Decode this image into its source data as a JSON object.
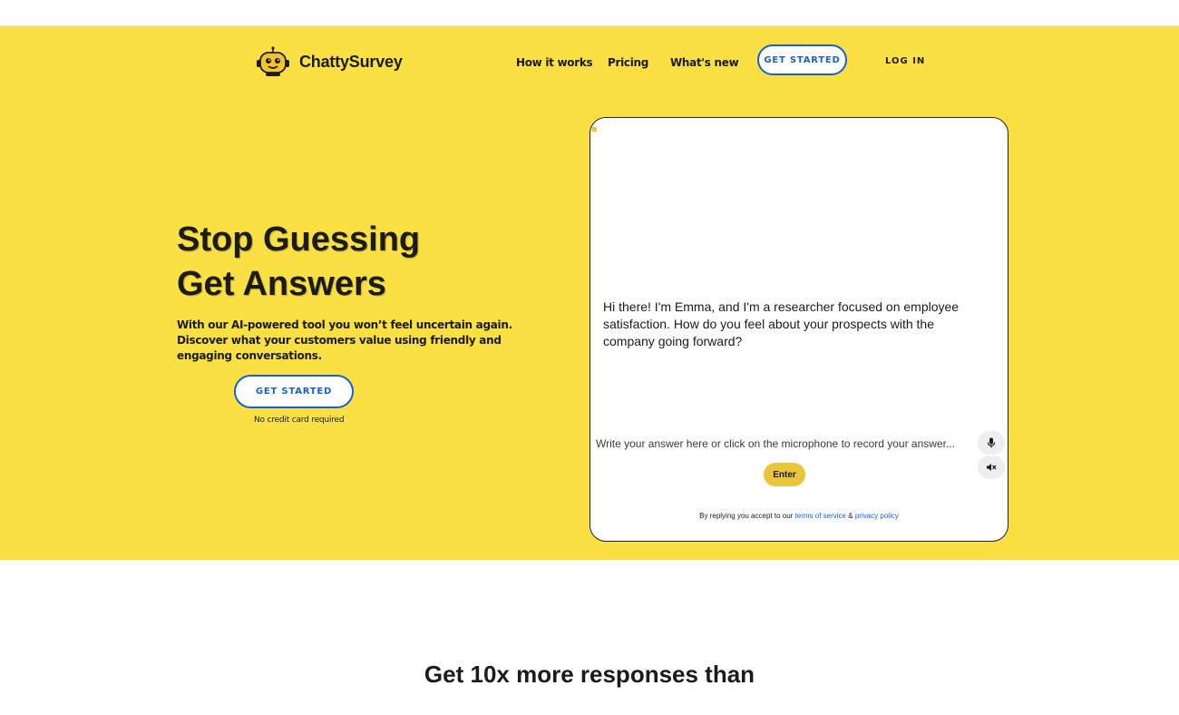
{
  "brand": {
    "name": "ChattySurvey",
    "logo_icon": "robot-mascot-icon"
  },
  "nav": {
    "links": [
      "How it works",
      "Pricing",
      "What's new"
    ],
    "get_started": "GET STARTED",
    "log_in": "LOG IN"
  },
  "hero": {
    "headline_line1": "Stop Guessing",
    "headline_line2": "Get Answers",
    "subtext": "With our AI-powered tool you won’t feel uncertain again. Discover what your customers value using friendly and engaging conversations.",
    "cta_label": "GET STARTED",
    "cta_note": "No credit card required"
  },
  "chat": {
    "bot_message": "Hi there! I'm Emma, and I'm a researcher focused on employee satisfaction. How do you feel about your prospects with the company going forward?",
    "input_placeholder": "Write your answer here or click on the microphone to record your answer...",
    "mic_icon": "microphone-icon",
    "mute_icon": "speaker-mute-icon",
    "enter_label": "Enter",
    "terms_prefix": "By replying you accept to our",
    "terms_link": "terms of service",
    "terms_and": "&",
    "privacy_link": "privacy policy"
  },
  "section": {
    "title": "Get 10x more responses than"
  },
  "colors": {
    "hero_bg": "#fbe043",
    "accent_blue": "#1a5fd1",
    "enter_bg": "#e8c53a"
  }
}
